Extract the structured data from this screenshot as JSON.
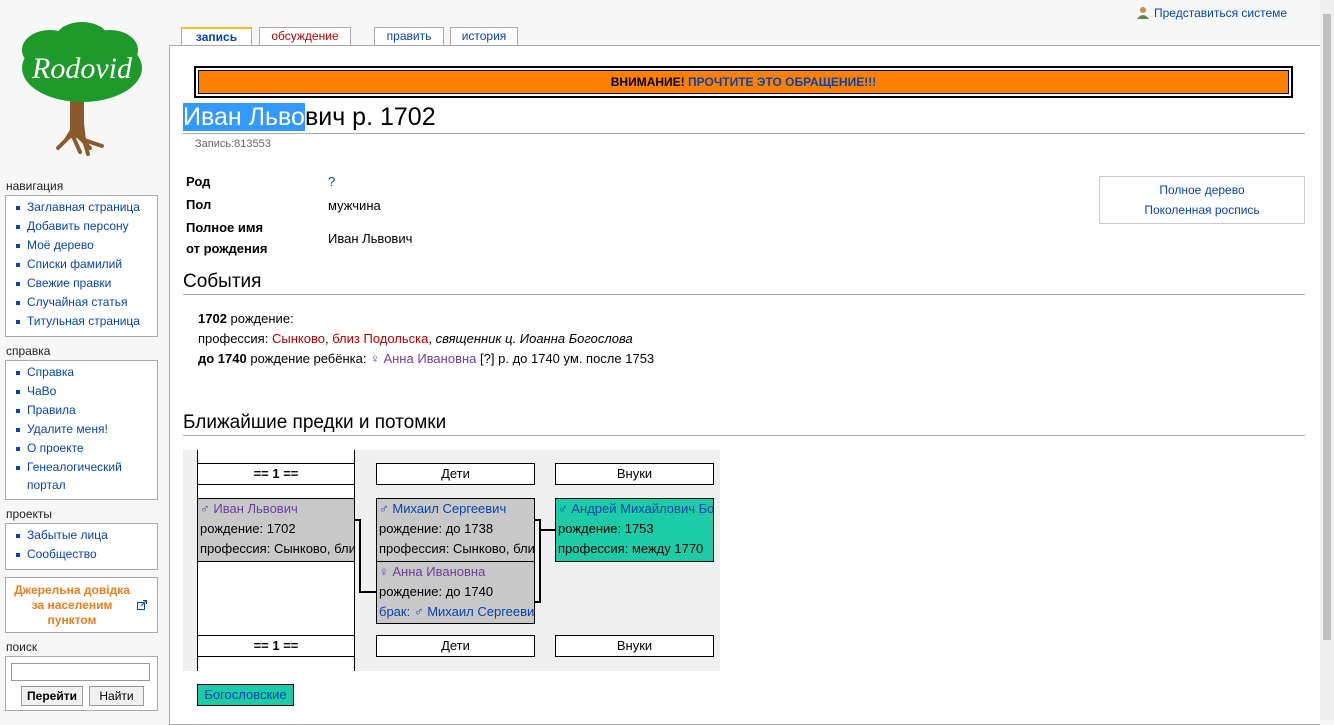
{
  "site": {
    "logo_text": "Rodovid",
    "login": "Представиться системе"
  },
  "tabs": [
    {
      "label": "запись",
      "selected": true
    },
    {
      "label": "обсуждение",
      "redlink": true
    },
    {
      "label": "править"
    },
    {
      "label": "история"
    }
  ],
  "notice": {
    "attention": "ВНИМАНИЕ!",
    "link": "ПРОЧТИТЕ ЭТО ОБРАЩЕНИЕ!!!"
  },
  "page": {
    "title_highlighted": "Иван Льво",
    "title_rest": "вич р. 1702",
    "record_id": "Запись:813553"
  },
  "infobox": {
    "rod_label": "Род",
    "rod_value": "?",
    "sex_label": "Пол",
    "sex_value": "мужчина",
    "fullname_label_1": "Полное имя",
    "fullname_label_2": "от рождения",
    "fullname_value": "Иван Львович"
  },
  "sidebox": {
    "full_tree": "Полное дерево",
    "generations": "Поколенная роспись"
  },
  "events": {
    "heading": "События",
    "e1_year": "1702",
    "e1_type": "рождение:",
    "e2_prefix": "профессия:",
    "e2_place1": "Сынково",
    "e2_comma1": ",",
    "e2_place2": "близ Подольска",
    "e2_comma2": ",",
    "e2_job": "священник ц. Иоанна Богослова",
    "e3_year": "до 1740",
    "e3_type": "рождение ребёнка:",
    "e3_sym": "♀",
    "e3_name": "Анна Ивановна",
    "e3_q": "[?]",
    "e3_rest": "р. до 1740 ум. после 1753"
  },
  "tree": {
    "heading": "Ближайшие предки и потомки",
    "gen_header": "== 1 ==",
    "children_header": "Дети",
    "grandchildren_header": "Внуки",
    "self": {
      "sym": "♂",
      "name": "Иван Львович",
      "birth": "рождение: 1702",
      "profession": "профессия: Сынково, близ Подольска"
    },
    "child1": {
      "sym": "♂",
      "name": "Михаил Сергеевич",
      "birth": "рождение: до 1738",
      "profession": "профессия: Сынково, близ Подольска"
    },
    "child2": {
      "sym": "♀",
      "name": "Анна Ивановна",
      "birth": "рождение: до 1740",
      "marriage_label": "брак:",
      "spouse_sym": "♂",
      "spouse": "Михаил Сергеевич"
    },
    "grandchild": {
      "sym": "♂",
      "name": "Андрей Михайлович Богословский",
      "birth": "рождение: 1753",
      "profession": "профессия: между 1770"
    }
  },
  "category": "Богословские",
  "sidebar": {
    "navigation_title": "навигация",
    "navigation": [
      "Заглавная страница",
      "Добавить персону",
      "Моё дерево",
      "Списки фамилий",
      "Свежие правки",
      "Случайная статья",
      "Титульная страница"
    ],
    "help_title": "справка",
    "help": [
      "Справка",
      "ЧаВо",
      "Правила",
      "Удалите меня!",
      "О проекте"
    ],
    "help_portal_1": "Генеалогический",
    "help_portal_2": "портал",
    "projects_title": "проекты",
    "projects": [
      "Забытые лица",
      "Сообщество"
    ],
    "jerelna_1": "Джерельна довідка",
    "jerelna_2": "за населеним",
    "jerelna_3": "пунктом",
    "search_title": "поиск",
    "search_value": "",
    "go_button": "Перейти",
    "find_button": "Найти"
  },
  "colors": {
    "notice_bg": "#ff8000",
    "link": "#0645ad",
    "redlink": "#ba0000",
    "teal_box": "#1ccca9",
    "gray_box": "#c8c8c8",
    "tab_selected": "#fabd23",
    "jerelna": "#ee7d1c"
  }
}
